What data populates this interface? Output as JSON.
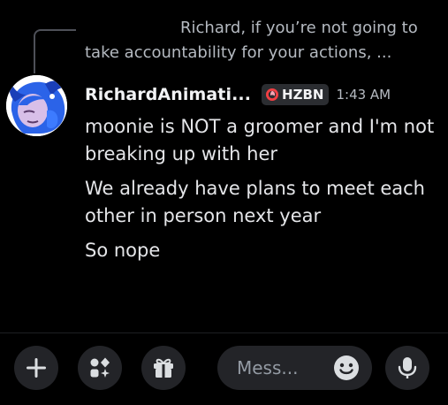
{
  "reply": {
    "line1": "Richard, if you’re not going to",
    "line2": "take accountability for your actions, ..."
  },
  "message": {
    "username": "RichardAnimati...",
    "tag": "HZBN",
    "timestamp": "1:43 AM",
    "lines": [
      "moonie is NOT a groomer and I'm not breaking up with her",
      "We already have plans to meet each other in person next year",
      "So nope"
    ]
  },
  "composer": {
    "placeholder": "Mess..."
  },
  "icons": {
    "add": "plus-icon",
    "apps": "apps-icon",
    "gift": "gift-icon",
    "emoji": "emoji-icon",
    "voice": "microphone-icon",
    "tag": "hazbin-badge-icon"
  },
  "colors": {
    "background": "#000000",
    "button_bg": "#232428",
    "tag_accent": "#f23f43"
  }
}
